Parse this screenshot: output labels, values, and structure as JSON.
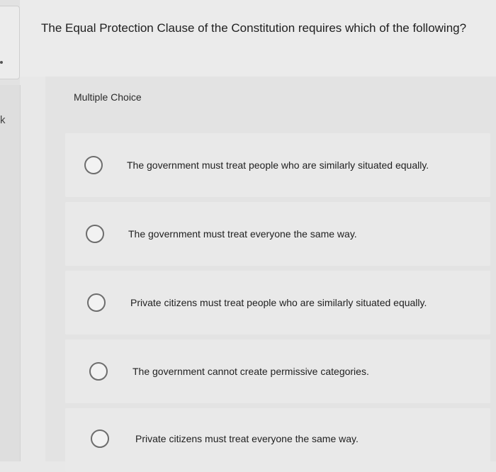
{
  "left_rail": {
    "letter": "k"
  },
  "question": {
    "text": "The Equal Protection Clause of the Constitution requires which of the following?"
  },
  "choice_section": {
    "label": "Multiple Choice"
  },
  "options": [
    {
      "text": "The government must treat people who are similarly situated equally."
    },
    {
      "text": "The government must treat everyone the same way."
    },
    {
      "text": "Private citizens must treat people who are similarly situated equally."
    },
    {
      "text": "The government cannot create permissive categories."
    },
    {
      "text": "Private citizens must treat everyone the same way."
    }
  ]
}
